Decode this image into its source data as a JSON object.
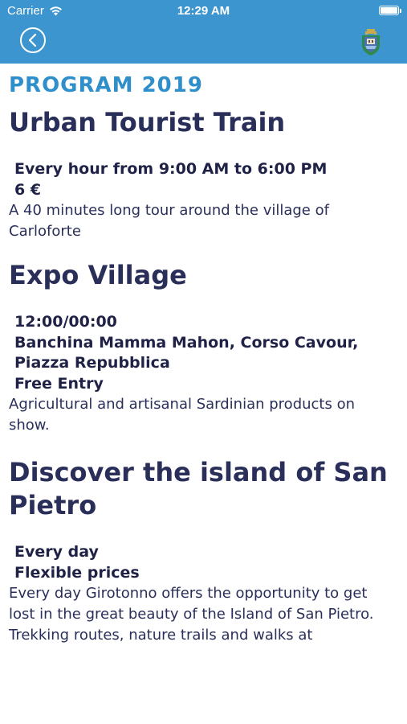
{
  "status": {
    "carrier": "Carrier",
    "time": "12:29 AM"
  },
  "nav": {
    "back_icon": "chevron-left-icon",
    "crest_icon": "town-crest-icon",
    "accent_color": "#3d95cf"
  },
  "program": {
    "title": "PROGRAM 2019"
  },
  "events": [
    {
      "title": "Urban Tourist Train",
      "meta": [
        "Every hour from 9:00 AM to 6:00 PM",
        "6 €"
      ],
      "description": "A 40 minutes long tour around the village of Carloforte"
    },
    {
      "title": "Expo Village",
      "meta": [
        "12:00/00:00",
        "Banchina Mamma Mahon, Corso Cavour, Piazza Repubblica",
        "Free Entry"
      ],
      "description": "Agricultural and artisanal Sardinian products on show."
    },
    {
      "title": "Discover the island of San Pietro",
      "meta": [
        "Every day",
        "Flexible prices"
      ],
      "description": "Every day Girotonno offers the opportunity to get lost in the great beauty of the Island of San Pietro.",
      "description2": "Trekking routes, nature trails and walks at"
    }
  ]
}
